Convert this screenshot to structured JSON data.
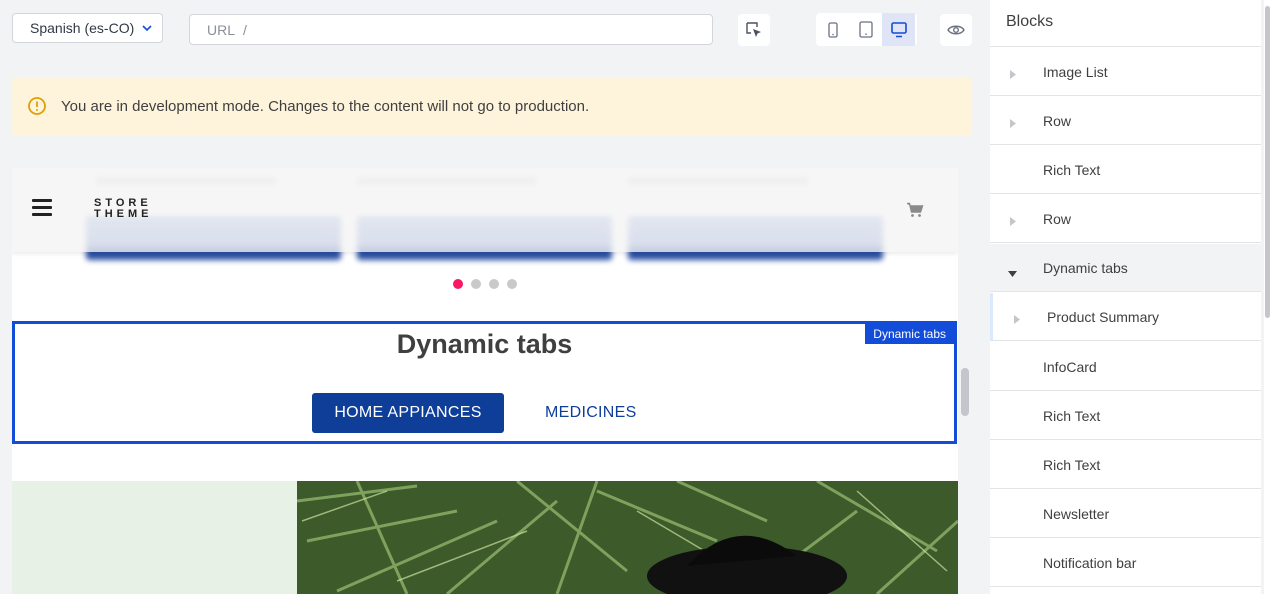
{
  "toolbar": {
    "locale": "Spanish (es-CO)",
    "url_label": "URL",
    "url_value": "/"
  },
  "alert": {
    "message": "You are in development mode. Changes to the content will not go to production."
  },
  "preview": {
    "store_logo_line1": "STORE",
    "store_logo_line2": "THEME",
    "block_tag": "Dynamic tabs",
    "section_title": "Dynamic tabs",
    "tabs": [
      {
        "label": "HOME APPIANCES",
        "active": true
      },
      {
        "label": "MEDICINES",
        "active": false
      }
    ],
    "carousel_dots": 4,
    "carousel_active_dot": 1
  },
  "panel": {
    "title": "Blocks",
    "items": [
      {
        "label": "Image List",
        "caret": "right"
      },
      {
        "label": "Row",
        "caret": "right"
      },
      {
        "label": "Rich Text",
        "caret": "none"
      },
      {
        "label": "Row",
        "caret": "right"
      },
      {
        "label": "Dynamic tabs",
        "caret": "down"
      },
      {
        "label": "Product Summary",
        "caret": "right"
      },
      {
        "label": "InfoCard",
        "caret": "none"
      },
      {
        "label": "Rich Text",
        "caret": "none"
      },
      {
        "label": "Rich Text",
        "caret": "none"
      },
      {
        "label": "Newsletter",
        "caret": "none"
      },
      {
        "label": "Notification bar",
        "caret": "none"
      }
    ]
  },
  "colors": {
    "accent": "#134cd8",
    "tab_active_bg": "#0f3e99",
    "dot_active": "#f71963",
    "alert_bg": "#fef4dc",
    "warn_icon": "#e0a000"
  },
  "icons": [
    "chevron-down-icon",
    "cursor-select-icon",
    "mobile-icon",
    "tablet-icon",
    "desktop-icon",
    "eye-icon",
    "warning-icon",
    "hamburger-icon",
    "cart-icon",
    "caret-right-icon",
    "caret-down-icon"
  ]
}
